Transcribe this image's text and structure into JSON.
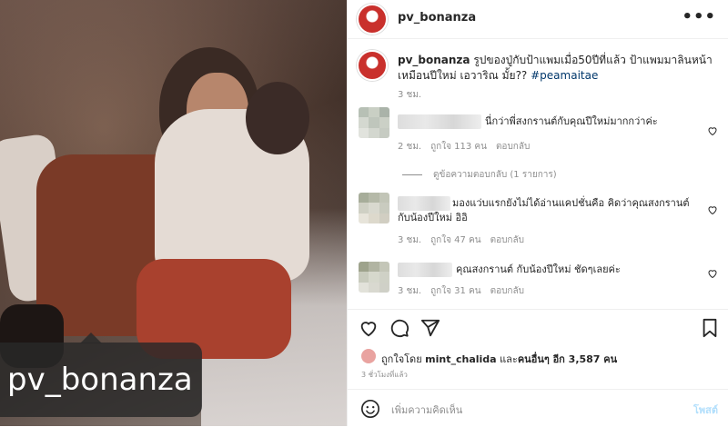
{
  "photo": {
    "watermark": "pv_bonanza"
  },
  "post": {
    "username": "pv_bonanza",
    "caption_user": "pv_bonanza",
    "caption_text": " รูปของปู่กับป้าแพมเมื่อ50ปีที่แล้ว ป้าแพมมาลินหน้าเหมือนปีใหม่ เอวาริณ มั้ย?? ",
    "hashtag": "#peamaitae",
    "caption_time": "3 ชม."
  },
  "comments": [
    {
      "text": "นี่กว่าพี่สงกรานต์กับคุณปีใหม่มากกว่าค่ะ",
      "time": "2 ชม.",
      "likes": "ถูกใจ 113 คน",
      "reply": "ตอบกลับ",
      "view_replies": "ดูข้อความตอบกลับ (1 รายการ)"
    },
    {
      "text": "มองแว่บแรกยังไม่ได้อ่านแคปชั่นคือ คิดว่าคุณสงกรานต์กับน้องปีใหม่ อิอิ",
      "time": "3 ชม.",
      "likes": "ถูกใจ 47 คน",
      "reply": "ตอบกลับ"
    },
    {
      "text": "คุณสงกรานต์ กับน้องปีใหม่ ชัดๆเลยค่ะ",
      "time": "3 ชม.",
      "likes": "ถูกใจ 31 คน",
      "reply": "ตอบกลับ"
    }
  ],
  "likes": {
    "prefix": "ถูกใจโดย ",
    "user": "mint_chalida",
    "middle": " และ",
    "others": "คนอื่นๆ อีก 3,587 คน"
  },
  "time_ago": "3 ชั่วโมงที่แล้ว",
  "add_comment": {
    "placeholder": "เพิ่มความคิดเห็น",
    "post_label": "โพสต์"
  }
}
